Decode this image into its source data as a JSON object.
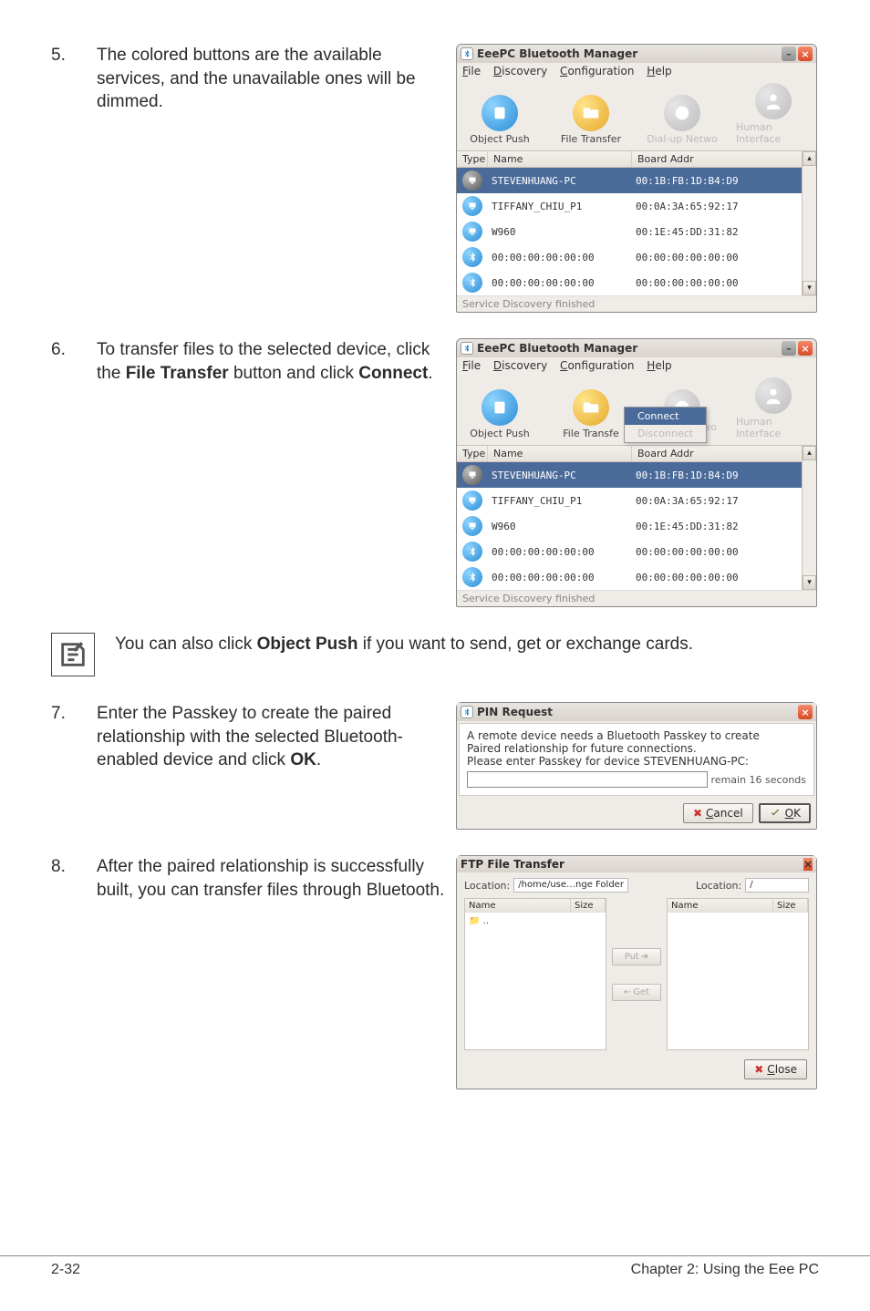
{
  "steps": {
    "s5": {
      "num": "5.",
      "text": "The colored buttons are the available services, and the unavailable ones will be dimmed."
    },
    "s6": {
      "num": "6.",
      "text_a": "To transfer files to the selected device, click the ",
      "text_b": "File Transfer",
      "text_c": " button and click ",
      "text_d": "Connect",
      "text_e": "."
    },
    "s7": {
      "num": "7.",
      "text_a": "Enter the Passkey to create the paired relationship with the selected Bluetooth-enabled device and click ",
      "text_b": "OK",
      "text_c": "."
    },
    "s8": {
      "num": "8.",
      "text": "After the paired relationship is successfully built, you can transfer files through Bluetooth."
    }
  },
  "note": {
    "text_a": "You can also click ",
    "text_b": "Object Push",
    "text_c": " if you want to send, get or exchange cards."
  },
  "btwin": {
    "title": "EeePC Bluetooth Manager",
    "menu": {
      "file": "File",
      "discovery": "Discovery",
      "config": "Configuration",
      "help": "Help"
    },
    "toolbar": {
      "push": "Object Push",
      "transfer": "File Transfer",
      "transfer_short": "File Transfe",
      "dial": "Dial-up Netwo",
      "hid": "Human Interface"
    },
    "cols": {
      "type": "Type",
      "name": "Name",
      "addr": "Board Addr"
    },
    "rows": [
      {
        "name": "STEVENHUANG-PC",
        "addr": "00:1B:FB:1D:B4:D9",
        "sel": true,
        "icon": "pc"
      },
      {
        "name": "TIFFANY_CHIU_P1",
        "addr": "00:0A:3A:65:92:17",
        "sel": false,
        "icon": "pc"
      },
      {
        "name": "W960",
        "addr": "00:1E:45:DD:31:82",
        "sel": false,
        "icon": "pc"
      },
      {
        "name": "00:00:00:00:00:00",
        "addr": "00:00:00:00:00:00",
        "sel": false,
        "icon": "bt"
      },
      {
        "name": "00:00:00:00:00:00",
        "addr": "00:00:00:00:00:00",
        "sel": false,
        "icon": "bt"
      }
    ],
    "status": "Service Discovery finished",
    "ctx": {
      "connect": "Connect",
      "disconnect": "Disconnect"
    }
  },
  "pin": {
    "title": "PIN Request",
    "body1": "A remote device needs a Bluetooth Passkey to create",
    "body2": "Paired relationship for future connections.",
    "body3": "Please enter Passkey for device STEVENHUANG-PC:",
    "remain": "remain 16 seconds",
    "cancel": "Cancel",
    "ok": "OK"
  },
  "ftp": {
    "title": "FTP File Transfer",
    "loc_label": "Location:",
    "loc_left": "/home/use…nge Folder",
    "loc_right": "/",
    "col_name": "Name",
    "col_size": "Size",
    "up": "..",
    "put": "Put",
    "get": "Get",
    "close": "Close"
  },
  "footer": {
    "left": "2-32",
    "right": "Chapter 2: Using the Eee PC"
  }
}
